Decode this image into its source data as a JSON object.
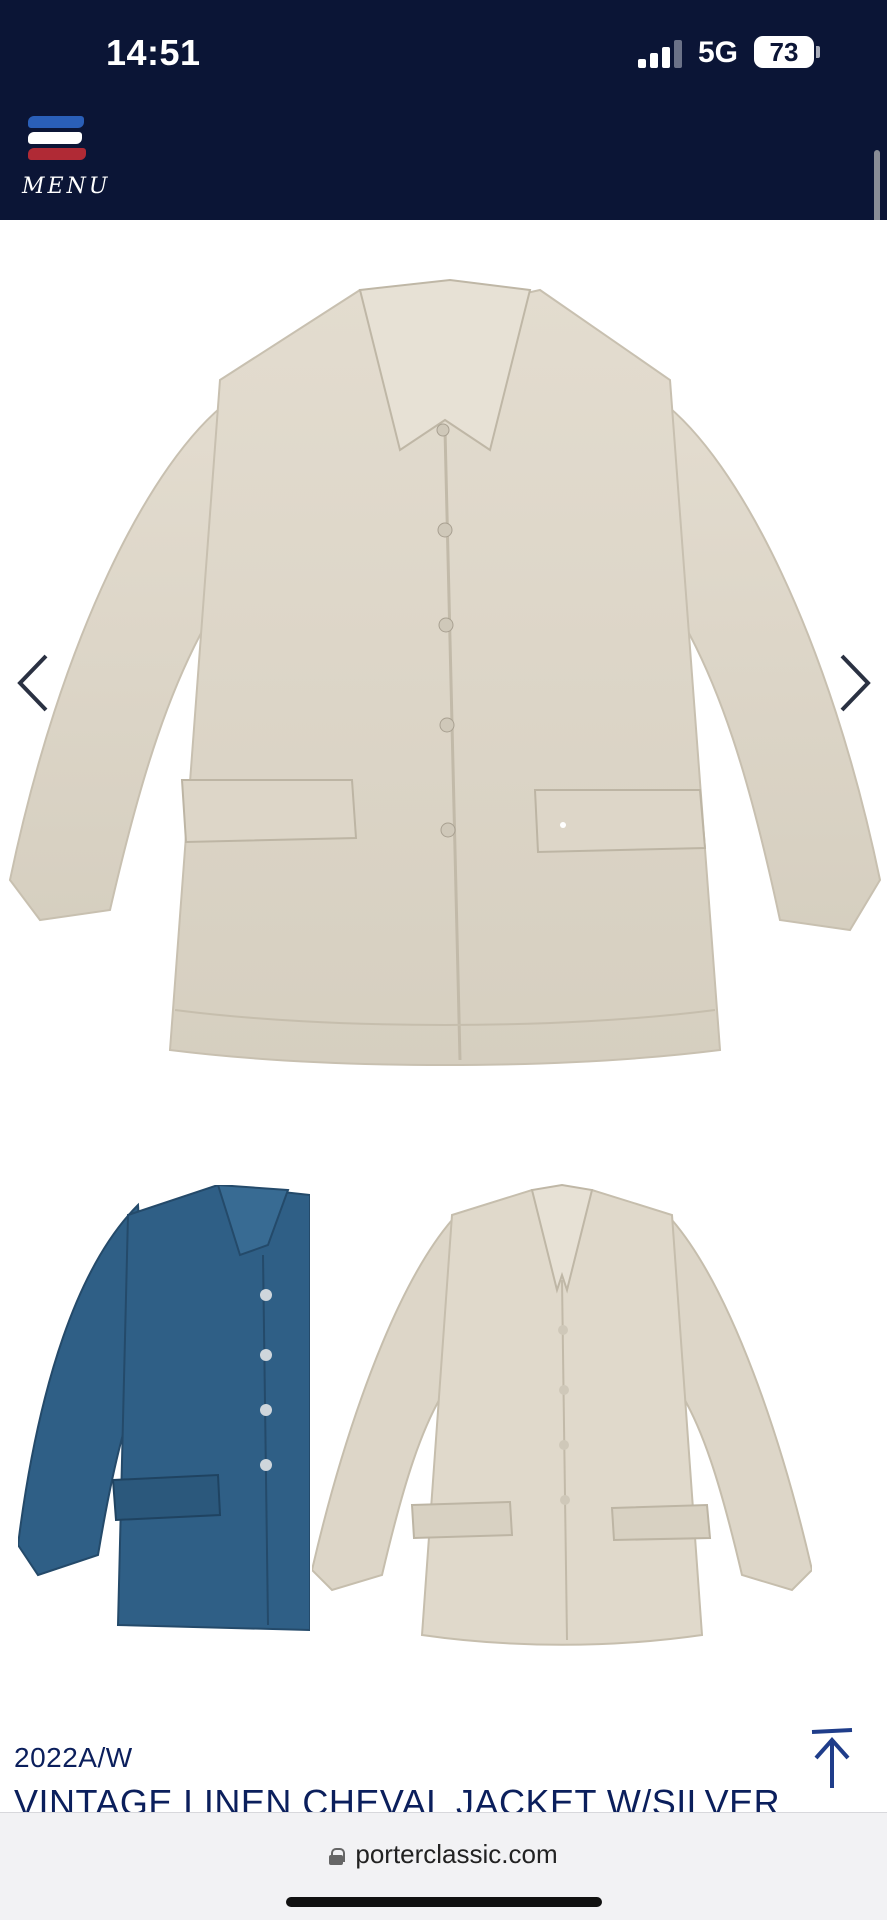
{
  "status_bar": {
    "time": "14:51",
    "network": "5G",
    "battery": "73"
  },
  "header": {
    "menu_label": "MENU",
    "logo_colors": [
      "#2a5fb8",
      "#ffffff",
      "#b02a35"
    ]
  },
  "gallery": {
    "prev_icon": "chevron-left-icon",
    "next_icon": "chevron-right-icon",
    "main_color": "#ddd6c8",
    "thumbnails": [
      {
        "color": "#2f5f86"
      },
      {
        "color": "#ddd6c8"
      }
    ]
  },
  "product": {
    "season": "2022A/W",
    "title": "VINTAGE LINEN CHEVAL JACKET W/SILVER",
    "back_to_top_icon": "arrow-up-icon"
  },
  "browser": {
    "url": "porterclassic.com"
  }
}
